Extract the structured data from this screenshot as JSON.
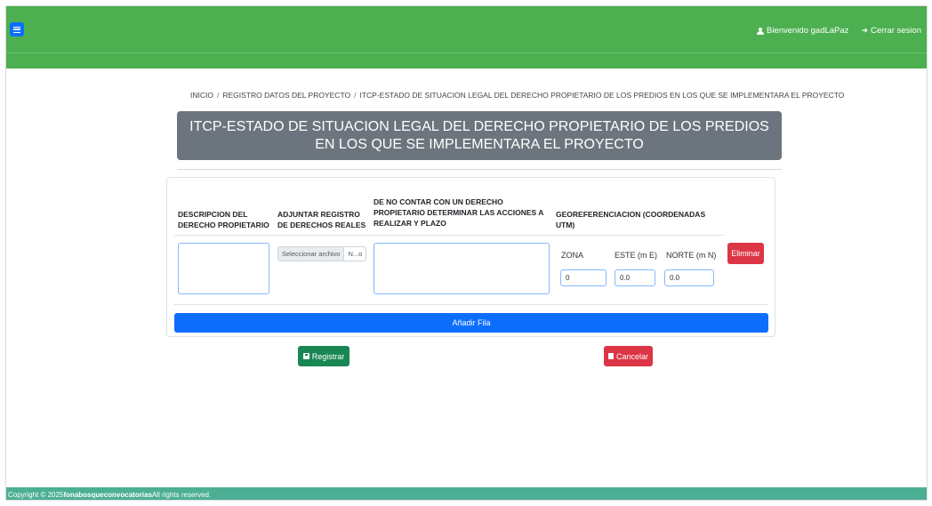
{
  "header": {
    "menu_icon": "hamburger-icon",
    "welcome": "Bienvenido gadLaPaz",
    "logout": "Cerrar sesion",
    "color": "#4caf50"
  },
  "breadcrumb": {
    "home": "INICIO",
    "separator": "/",
    "level1": "REGISTRO DATOS DEL PROYECTO",
    "level2": "ITCP-ESTADO DE SITUACION LEGAL DEL DERECHO PROPIETARIO DE LOS PREDIOS EN LOS QUE SE IMPLEMENTARA EL PROYECTO"
  },
  "page_title": "ITCP-ESTADO DE SITUACION LEGAL DEL DERECHO PROPIETARIO DE LOS PREDIOS EN LOS QUE SE IMPLEMENTARA EL PROYECTO",
  "table": {
    "headers": {
      "descripcion": "DESCRIPCION DEL DERECHO PROPIETARIO",
      "adjuntar": "ADJUNTAR REGISTRO DE DERECHOS REALES",
      "acciones": "DE NO CONTAR CON UN DERECHO PROPIETARIO DETERMINAR LAS ACCIONES A REALIZAR Y PLAZO",
      "georef": "GEOREFERENCIACION (COORDENADAS UTM)"
    },
    "row": {
      "descripcion": "",
      "file_button": "Seleccionar archivo",
      "file_name": "N...o",
      "acciones": "",
      "zona_label": "ZONA",
      "este_label": "ESTE (m E)",
      "norte_label": "NORTE (m N)",
      "zona_value": "0",
      "este_value": "0.0",
      "norte_value": "0.0",
      "delete_label": "Eliminar"
    },
    "add_row_label": "Añadir Fila"
  },
  "actions": {
    "register_label": "Registrar",
    "cancel_label": "Cancelar"
  },
  "footer": {
    "prefix": "Copyright © 2025 ",
    "brand": "fonabosqueconvocatorias",
    "suffix": " All rights reserved."
  },
  "colors": {
    "primary": "#0d6efd",
    "success": "#198754",
    "danger": "#dc3545",
    "title_bg": "#6c757d",
    "footer": "#4caf93"
  }
}
